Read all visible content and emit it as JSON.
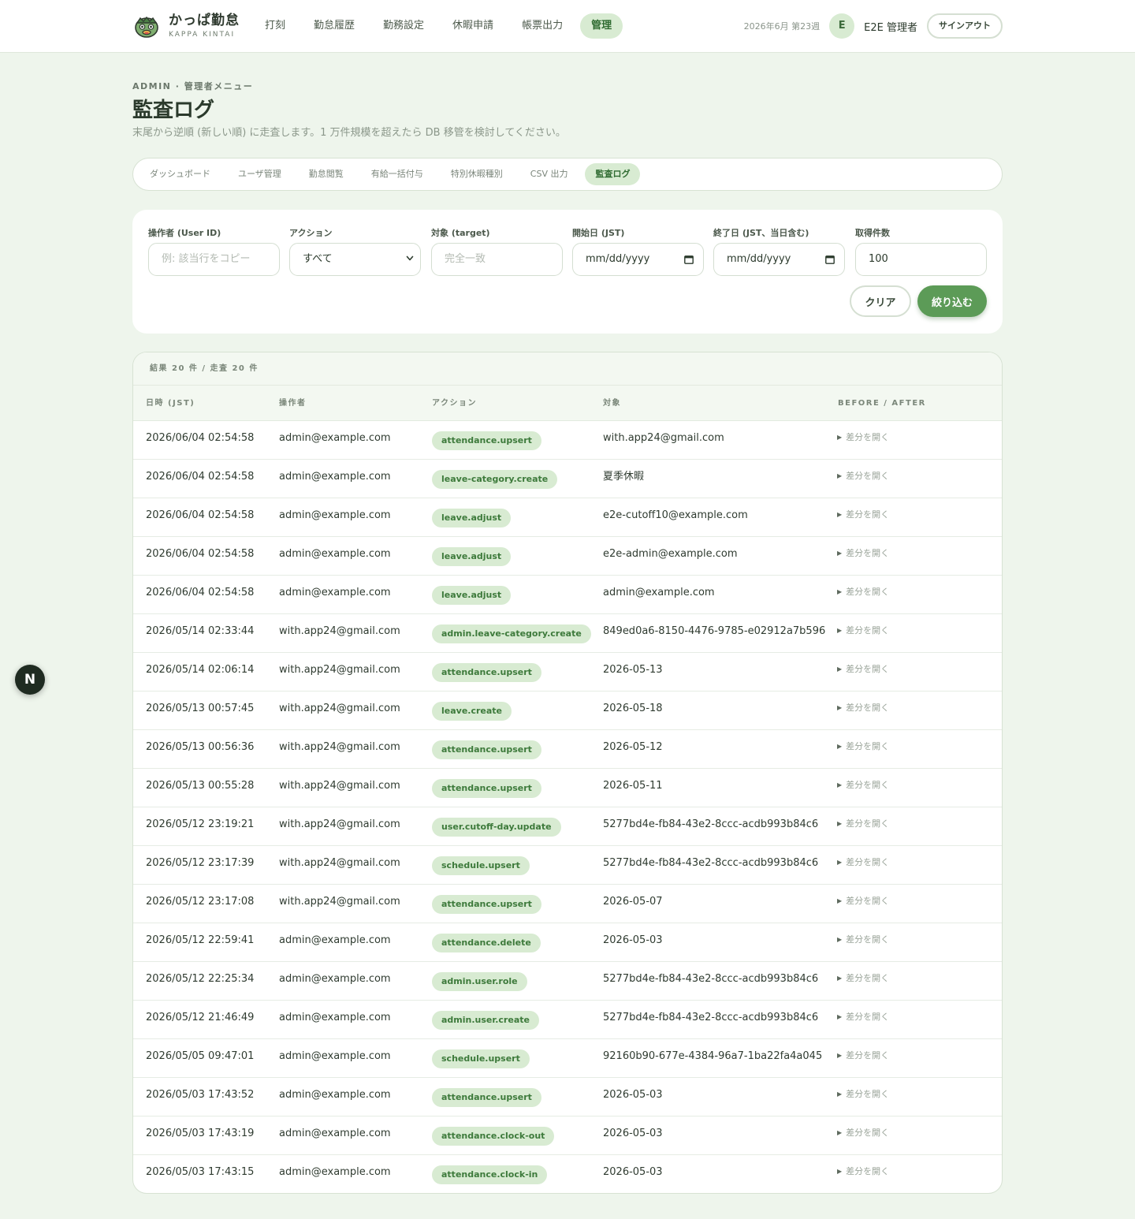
{
  "brand": {
    "name": "かっぱ勤怠",
    "sub": "KAPPA KINTAI"
  },
  "nav": [
    "打刻",
    "勤怠履歴",
    "勤務設定",
    "休暇申請",
    "帳票出力",
    "管理"
  ],
  "header": {
    "week": "2026年6月 第23週",
    "avatar_initial": "E",
    "user_name": "E2E 管理者",
    "signout": "サインアウト"
  },
  "page": {
    "eyebrow": "ADMIN · 管理者メニュー",
    "title": "監査ログ",
    "description": "末尾から逆順 (新しい順) に走査します。1 万件規模を超えたら DB 移管を検討してください。"
  },
  "tabs": [
    "ダッシュボード",
    "ユーザ管理",
    "勤怠閲覧",
    "有給一括付与",
    "特別休暇種別",
    "CSV 出力",
    "監査ログ"
  ],
  "filters": {
    "operator": {
      "label": "操作者 (User ID)",
      "placeholder": "例: 該当行をコピー"
    },
    "action": {
      "label": "アクション",
      "value": "すべて"
    },
    "target": {
      "label": "対象 (target)",
      "placeholder": "完全一致"
    },
    "start": {
      "label": "開始日 (JST)",
      "value": "mm/dd/yyyy"
    },
    "end": {
      "label": "終了日 (JST、当日含む)",
      "value": "mm/dd/yyyy"
    },
    "limit": {
      "label": "取得件数",
      "value": "100"
    },
    "clear_label": "クリア",
    "apply_label": "絞り込む"
  },
  "results": {
    "summary": "結果 20 件 / 走査 20 件",
    "columns": [
      "日時 (JST)",
      "操作者",
      "アクション",
      "対象",
      "BEFORE / AFTER"
    ],
    "diff_label": "差分を開く",
    "rows": [
      [
        "2026/06/04 02:54:58",
        "admin@example.com",
        "attendance.upsert",
        "with.app24@gmail.com"
      ],
      [
        "2026/06/04 02:54:58",
        "admin@example.com",
        "leave-category.create",
        "夏季休暇"
      ],
      [
        "2026/06/04 02:54:58",
        "admin@example.com",
        "leave.adjust",
        "e2e-cutoff10@example.com"
      ],
      [
        "2026/06/04 02:54:58",
        "admin@example.com",
        "leave.adjust",
        "e2e-admin@example.com"
      ],
      [
        "2026/06/04 02:54:58",
        "admin@example.com",
        "leave.adjust",
        "admin@example.com"
      ],
      [
        "2026/05/14 02:33:44",
        "with.app24@gmail.com",
        "admin.leave-category.create",
        "849ed0a6-8150-4476-9785-e02912a7b596"
      ],
      [
        "2026/05/14 02:06:14",
        "with.app24@gmail.com",
        "attendance.upsert",
        "2026-05-13"
      ],
      [
        "2026/05/13 00:57:45",
        "with.app24@gmail.com",
        "leave.create",
        "2026-05-18"
      ],
      [
        "2026/05/13 00:56:36",
        "with.app24@gmail.com",
        "attendance.upsert",
        "2026-05-12"
      ],
      [
        "2026/05/13 00:55:28",
        "with.app24@gmail.com",
        "attendance.upsert",
        "2026-05-11"
      ],
      [
        "2026/05/12 23:19:21",
        "with.app24@gmail.com",
        "user.cutoff-day.update",
        "5277bd4e-fb84-43e2-8ccc-acdb993b84c6"
      ],
      [
        "2026/05/12 23:17:39",
        "with.app24@gmail.com",
        "schedule.upsert",
        "5277bd4e-fb84-43e2-8ccc-acdb993b84c6"
      ],
      [
        "2026/05/12 23:17:08",
        "with.app24@gmail.com",
        "attendance.upsert",
        "2026-05-07"
      ],
      [
        "2026/05/12 22:59:41",
        "admin@example.com",
        "attendance.delete",
        "2026-05-03"
      ],
      [
        "2026/05/12 22:25:34",
        "admin@example.com",
        "admin.user.role",
        "5277bd4e-fb84-43e2-8ccc-acdb993b84c6"
      ],
      [
        "2026/05/12 21:46:49",
        "admin@example.com",
        "admin.user.create",
        "5277bd4e-fb84-43e2-8ccc-acdb993b84c6"
      ],
      [
        "2026/05/05 09:47:01",
        "admin@example.com",
        "schedule.upsert",
        "92160b90-677e-4384-96a7-1ba22fa4a045"
      ],
      [
        "2026/05/03 17:43:52",
        "admin@example.com",
        "attendance.upsert",
        "2026-05-03"
      ],
      [
        "2026/05/03 17:43:19",
        "admin@example.com",
        "attendance.clock-out",
        "2026-05-03"
      ],
      [
        "2026/05/03 17:43:15",
        "admin@example.com",
        "attendance.clock-in",
        "2026-05-03"
      ]
    ]
  },
  "fab_label": "N",
  "colors": {
    "accent": "#5c9b57",
    "badge_bg": "#d8ebd2",
    "badge_text": "#3d7a3b",
    "page_bg": "#eef5ec"
  },
  "icons": {
    "logo": "kappa-face-icon",
    "select": "chevron-down-icon",
    "date": "calendar-icon",
    "diff": "triangle-right-icon"
  }
}
